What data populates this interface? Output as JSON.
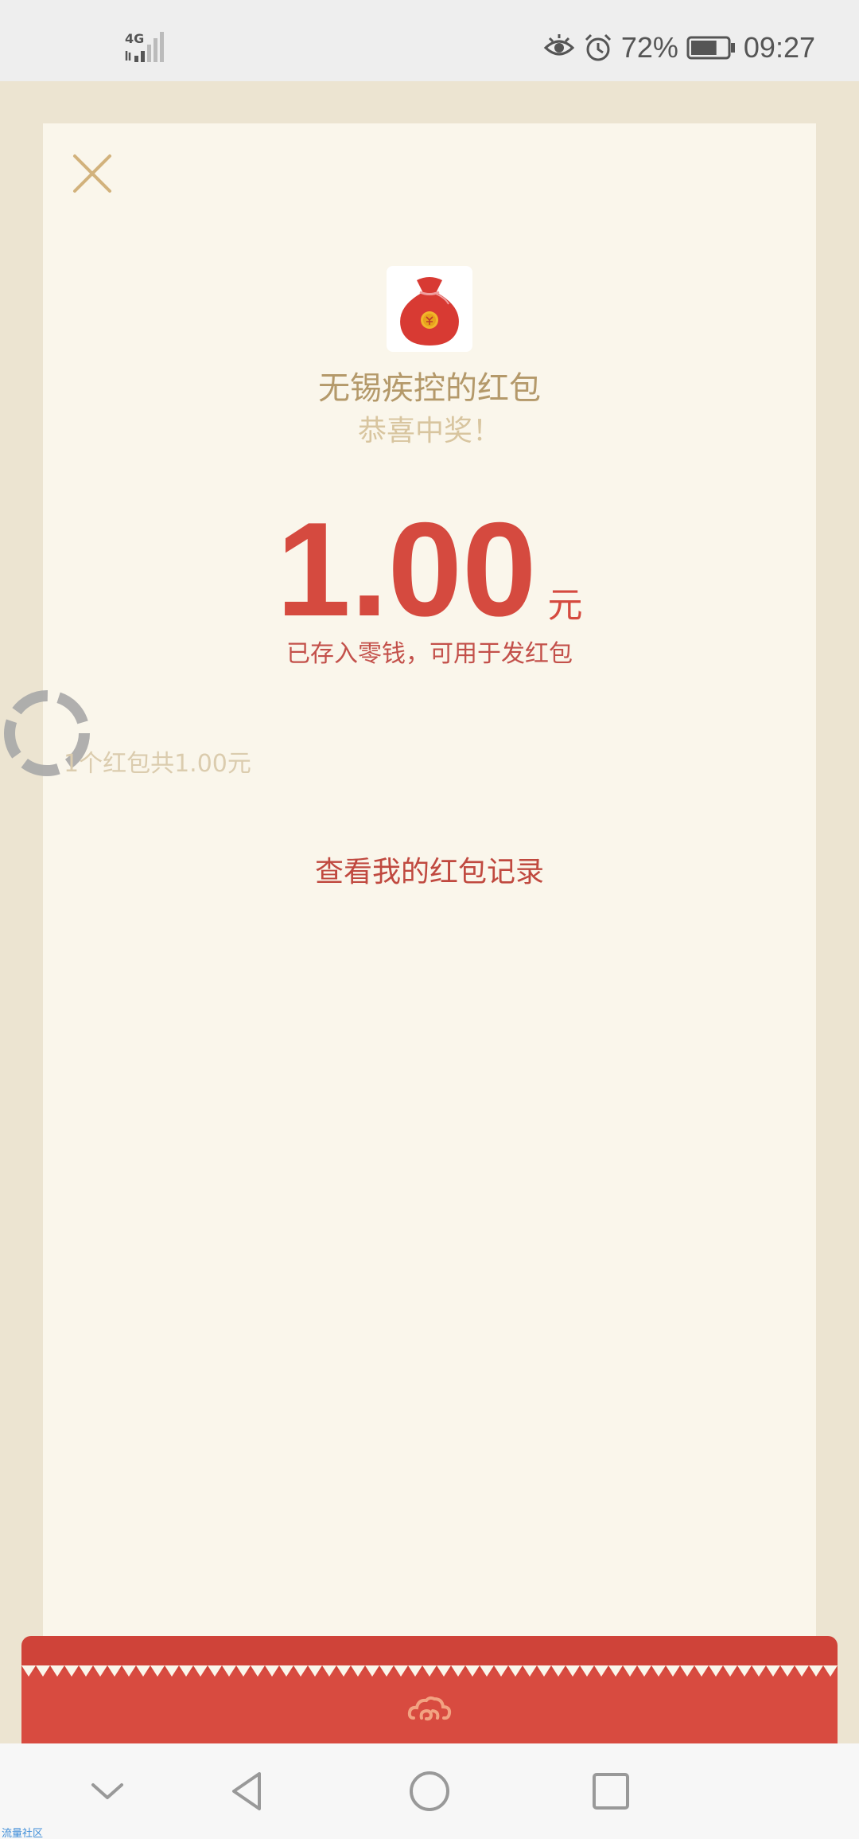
{
  "status_bar": {
    "network": "4G",
    "battery_percent": "72%",
    "battery_level": 0.72,
    "time": "09:27",
    "icons": [
      "eye-icon",
      "alarm-icon",
      "battery-icon",
      "signal-icon"
    ]
  },
  "red_packet": {
    "sender_title": "无锡疾控的红包",
    "congrats": "恭喜中奖！",
    "amount": "1.00",
    "unit": "元",
    "saved_note": "已存入零钱，可用于发红包",
    "summary": "1个红包共1.00元",
    "record_link": "查看我的红包记录"
  },
  "watermark": "流量社区",
  "colors": {
    "accent_red": "#d54a3f",
    "gold": "#b4996a",
    "card_bg": "#faf6eb",
    "page_bg": "#ece4d1"
  }
}
